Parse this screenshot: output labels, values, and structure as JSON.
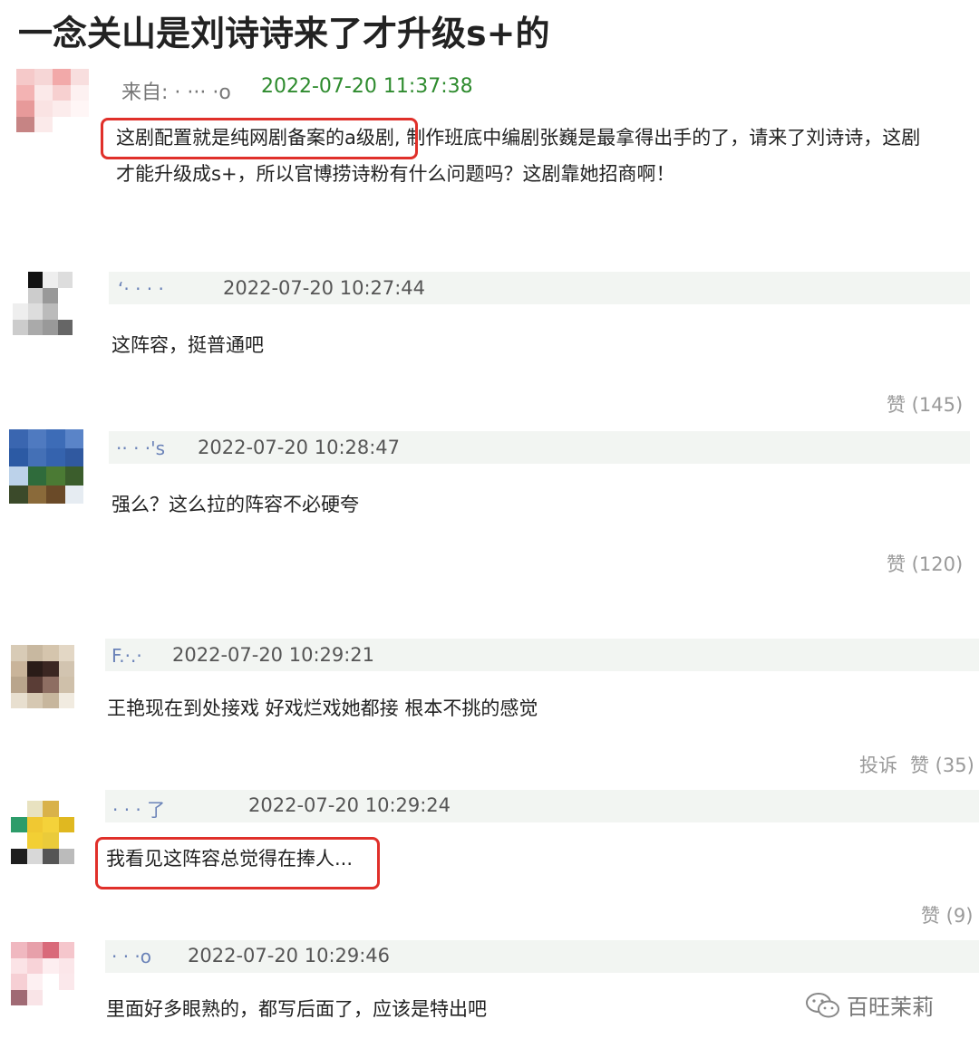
{
  "title": "一念关山是刘诗诗来了才升级s+的",
  "comments": [
    {
      "name": "来自: · ··· ·o",
      "time": "2022-07-20 11:37:38",
      "text_highlight": "这剧配置就是纯网剧备案的a级剧,",
      "text_rest_line1": " 制作班底中编剧张巍是最拿得出手的了，请来了刘诗诗，这剧",
      "text_line2": "才能升级成s+，所以官博捞诗粉有什么问题吗？这剧靠她招商啊！",
      "time_color": "#2e8b2e"
    },
    {
      "name": "‘· ·  · ·",
      "time": "2022-07-20 10:27:44",
      "text": "这阵容，挺普通吧",
      "likes": "赞 (145)"
    },
    {
      "name": "·· · ·'s",
      "time": "2022-07-20 10:28:47",
      "text": "强么？这么拉的阵容不必硬夸",
      "likes": "赞 (120)"
    },
    {
      "name": "F.·.·",
      "time": "2022-07-20 10:29:21",
      "text": "王艳现在到处接戏 好戏烂戏她都接 根本不挑的感觉",
      "report": "投诉",
      "likes": "赞 (35)"
    },
    {
      "name": "·  · · 了",
      "time": "2022-07-20 10:29:24",
      "text": "我看见这阵容总觉得在捧人...",
      "likes": "赞 (9)"
    },
    {
      "name": "· · ·o",
      "time": "2022-07-20 10:29:46",
      "text": "里面好多眼熟的，都写后面了，应该是特出吧"
    }
  ],
  "watermark": "百旺茉莉",
  "colors": {
    "highlight": "#e0302a",
    "meta_bar": "#f2f5f2",
    "name": "#6a82b8"
  }
}
